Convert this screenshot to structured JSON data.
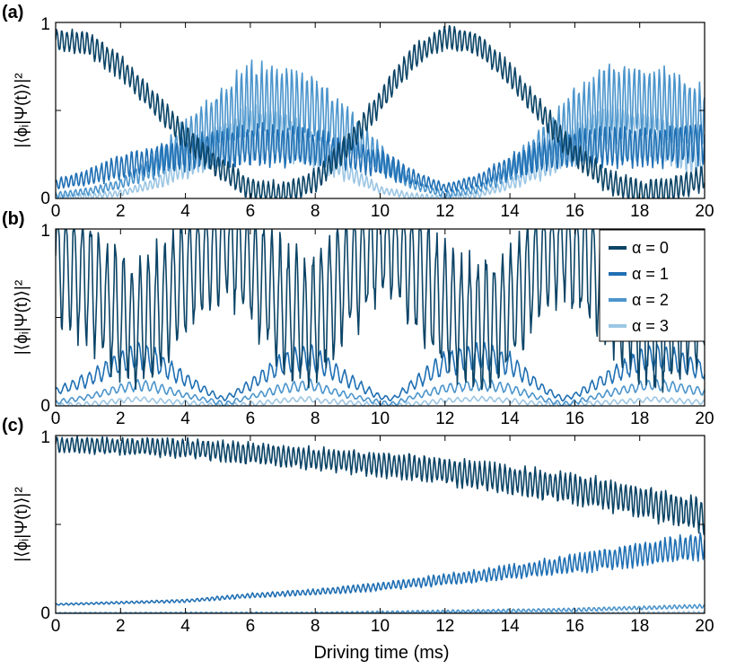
{
  "figure": {
    "xlabel": "Driving time (ms)",
    "ylabel": "|⟨ϕᵢ|Ψ(t)⟩|²",
    "x_ticks": [
      0,
      2,
      4,
      6,
      8,
      10,
      12,
      14,
      16,
      18,
      20
    ],
    "y_tick_labels": [
      "0",
      "1"
    ],
    "colors": [
      "#0b4466",
      "#1f6fb3",
      "#4c95cc",
      "#9cc6e4"
    ]
  },
  "legend": {
    "entries": [
      "α = 0",
      "α = 1",
      "α = 2",
      "α = 3"
    ]
  },
  "chart_data": [
    {
      "type": "line",
      "panel": "(a)",
      "xlim": [
        0,
        20
      ],
      "ylim": [
        0,
        1
      ],
      "grid": false,
      "note_envelope": "fast oscillation superimposed on slow Rabi-like envelope",
      "series": [
        {
          "name": "α = 0",
          "x": [
            0,
            1,
            2,
            3,
            4,
            5,
            6,
            7,
            8,
            9,
            10,
            11,
            12,
            13,
            14,
            15,
            16,
            17,
            18,
            19,
            20
          ],
          "y": [
            0.9,
            0.88,
            0.75,
            0.55,
            0.35,
            0.18,
            0.05,
            0.02,
            0.1,
            0.3,
            0.55,
            0.8,
            0.92,
            0.88,
            0.7,
            0.48,
            0.25,
            0.1,
            0.03,
            0.05,
            0.12
          ]
        },
        {
          "name": "α = 1",
          "x": [
            0,
            1,
            2,
            3,
            4,
            5,
            6,
            7,
            8,
            9,
            10,
            11,
            12,
            13,
            14,
            15,
            16,
            17,
            18,
            19,
            20
          ],
          "y": [
            0.08,
            0.12,
            0.18,
            0.22,
            0.25,
            0.28,
            0.3,
            0.3,
            0.28,
            0.25,
            0.2,
            0.12,
            0.06,
            0.1,
            0.18,
            0.24,
            0.28,
            0.3,
            0.3,
            0.3,
            0.32
          ]
        },
        {
          "name": "α = 2",
          "x": [
            0,
            1,
            2,
            3,
            4,
            5,
            6,
            7,
            8,
            9,
            10,
            11,
            12,
            13,
            14,
            15,
            16,
            17,
            18,
            19,
            20
          ],
          "y": [
            0.02,
            0.04,
            0.08,
            0.18,
            0.32,
            0.45,
            0.55,
            0.55,
            0.5,
            0.38,
            0.22,
            0.08,
            0.02,
            0.05,
            0.15,
            0.3,
            0.45,
            0.55,
            0.55,
            0.52,
            0.45
          ]
        },
        {
          "name": "α = 3",
          "x": [
            0,
            1,
            2,
            3,
            4,
            5,
            6,
            7,
            8,
            9,
            10,
            11,
            12,
            13,
            14,
            15,
            16,
            17,
            18,
            19,
            20
          ],
          "y": [
            0.0,
            0.01,
            0.03,
            0.08,
            0.18,
            0.3,
            0.38,
            0.36,
            0.28,
            0.15,
            0.05,
            0.01,
            0.0,
            0.02,
            0.08,
            0.18,
            0.3,
            0.38,
            0.36,
            0.3,
            0.2
          ]
        }
      ]
    },
    {
      "type": "line",
      "panel": "(b)",
      "xlim": [
        0,
        20
      ],
      "ylim": [
        0,
        1
      ],
      "grid": false,
      "legend_position": "top-right",
      "series": [
        {
          "name": "α = 0",
          "x": [
            0,
            1,
            2,
            2.6,
            3,
            4,
            5,
            5.2,
            6,
            7,
            7.8,
            8,
            9,
            10,
            10.4,
            11,
            12,
            13,
            13.2,
            14,
            15,
            15.6,
            16,
            17,
            18,
            18.4,
            19,
            20
          ],
          "y": [
            0.85,
            0.7,
            0.5,
            0.45,
            0.5,
            0.75,
            0.95,
            0.96,
            0.8,
            0.55,
            0.45,
            0.5,
            0.75,
            0.95,
            0.96,
            0.8,
            0.55,
            0.45,
            0.45,
            0.55,
            0.85,
            0.96,
            0.9,
            0.7,
            0.5,
            0.45,
            0.5,
            0.6
          ]
        },
        {
          "name": "α = 1",
          "x": [
            0,
            1,
            2,
            2.6,
            3,
            4,
            5,
            5.2,
            6,
            7,
            7.8,
            8,
            9,
            10,
            10.4,
            11,
            12,
            13,
            13.2,
            14,
            15,
            15.6,
            16,
            17,
            18,
            18.4,
            19,
            20
          ],
          "y": [
            0.08,
            0.15,
            0.25,
            0.28,
            0.26,
            0.15,
            0.05,
            0.04,
            0.12,
            0.24,
            0.28,
            0.26,
            0.15,
            0.05,
            0.04,
            0.12,
            0.24,
            0.28,
            0.28,
            0.24,
            0.1,
            0.04,
            0.06,
            0.16,
            0.25,
            0.28,
            0.26,
            0.2
          ]
        },
        {
          "name": "α = 2",
          "x": [
            0,
            1,
            2,
            2.6,
            3,
            4,
            5,
            5.2,
            6,
            7,
            7.8,
            8,
            9,
            10,
            10.4,
            11,
            12,
            13,
            13.2,
            14,
            15,
            15.6,
            16,
            17,
            18,
            18.4,
            19,
            20
          ],
          "y": [
            0.02,
            0.05,
            0.1,
            0.12,
            0.11,
            0.06,
            0.02,
            0.01,
            0.05,
            0.1,
            0.12,
            0.11,
            0.06,
            0.02,
            0.01,
            0.05,
            0.1,
            0.12,
            0.12,
            0.1,
            0.04,
            0.01,
            0.02,
            0.07,
            0.11,
            0.12,
            0.11,
            0.08
          ]
        },
        {
          "name": "α = 3",
          "x": [
            0,
            1,
            2,
            2.6,
            3,
            4,
            5,
            5.2,
            6,
            7,
            7.8,
            8,
            9,
            10,
            10.4,
            11,
            12,
            13,
            13.2,
            14,
            15,
            15.6,
            16,
            17,
            18,
            18.4,
            19,
            20
          ],
          "y": [
            0.0,
            0.01,
            0.03,
            0.04,
            0.03,
            0.02,
            0.0,
            0.0,
            0.01,
            0.03,
            0.04,
            0.03,
            0.02,
            0.0,
            0.0,
            0.01,
            0.03,
            0.04,
            0.04,
            0.03,
            0.01,
            0.0,
            0.01,
            0.02,
            0.03,
            0.04,
            0.03,
            0.02
          ]
        }
      ]
    },
    {
      "type": "line",
      "panel": "(c)",
      "xlim": [
        0,
        20
      ],
      "ylim": [
        0,
        1
      ],
      "grid": false,
      "series": [
        {
          "name": "α = 0",
          "x": [
            0,
            2,
            4,
            6,
            8,
            10,
            12,
            14,
            16,
            18,
            20
          ],
          "y": [
            0.95,
            0.94,
            0.93,
            0.9,
            0.87,
            0.84,
            0.8,
            0.75,
            0.7,
            0.63,
            0.55
          ]
        },
        {
          "name": "α = 1",
          "x": [
            0,
            2,
            4,
            6,
            8,
            10,
            12,
            14,
            16,
            18,
            20
          ],
          "y": [
            0.05,
            0.06,
            0.07,
            0.1,
            0.12,
            0.15,
            0.19,
            0.23,
            0.28,
            0.33,
            0.38
          ]
        },
        {
          "name": "α = 2",
          "x": [
            0,
            2,
            4,
            6,
            8,
            10,
            12,
            14,
            16,
            18,
            20
          ],
          "y": [
            0.0,
            0.0,
            0.0,
            0.0,
            0.0,
            0.005,
            0.01,
            0.015,
            0.02,
            0.03,
            0.04
          ]
        },
        {
          "name": "α = 3",
          "x": [
            0,
            2,
            4,
            6,
            8,
            10,
            12,
            14,
            16,
            18,
            20
          ],
          "y": [
            0.0,
            0.0,
            0.0,
            0.0,
            0.0,
            0.0,
            0.0,
            0.0,
            0.0,
            0.0,
            0.0
          ]
        }
      ]
    }
  ]
}
